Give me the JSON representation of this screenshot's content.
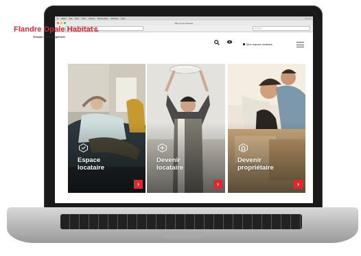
{
  "macos": {
    "menu_items": [
      "Safari",
      "File",
      "Edit",
      "View",
      "History",
      "Bookmarks",
      "Window",
      "Help"
    ],
    "window_title": "Title of your browser",
    "url": "http://www.flandreopalehabitat.fr",
    "search_placeholder": "Google"
  },
  "site": {
    "logo_text": "Flandre Opale Habitat",
    "logo_swirl": "&",
    "logo_subtitle": "Groupe ActionLogement",
    "account_label": "Mon espace locataire",
    "accent_color": "#e0262f"
  },
  "cards": [
    {
      "title": "Espace\nlocataire",
      "arrow": "›"
    },
    {
      "title": "Devenir\nlocataire",
      "arrow": "›"
    },
    {
      "title": "Devenir\npropriétaire",
      "arrow": "›"
    }
  ]
}
